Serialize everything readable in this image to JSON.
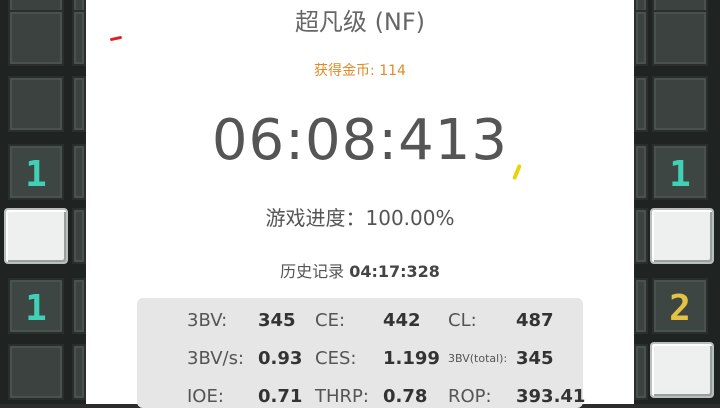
{
  "title": "超凡级 (NF)",
  "coins": "获得金币: 114",
  "time": "06:08:413",
  "progress": "游戏进度：100.00%",
  "history": {
    "label": "历史记录",
    "value": "04:17:328"
  },
  "stats": {
    "bbbv": {
      "label": "3BV:",
      "value": "345"
    },
    "ce": {
      "label": "CE:",
      "value": "442"
    },
    "cl": {
      "label": "CL:",
      "value": "487"
    },
    "bbbv_s": {
      "label": "3BV/s:",
      "value": "0.93"
    },
    "ces": {
      "label": "CES:",
      "value": "1.199"
    },
    "bbbv_total": {
      "label": "3BV(total):",
      "value": "345"
    },
    "ioe": {
      "label": "IOE:",
      "value": "0.71"
    },
    "thrp": {
      "label": "THRP:",
      "value": "0.78"
    },
    "rop": {
      "label": "ROP:",
      "value": "393.41"
    }
  },
  "board": {
    "left_numbers": [
      "1",
      "1"
    ],
    "right_numbers": [
      "1",
      "2"
    ],
    "colors": {
      "one": "#3fd0b6",
      "two": "#e4c244"
    }
  }
}
